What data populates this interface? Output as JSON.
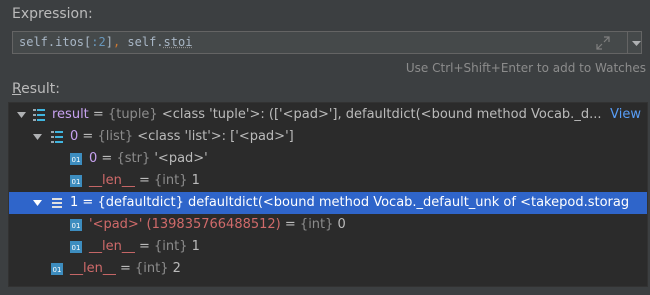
{
  "expression": {
    "label": "Expression:",
    "parts": [
      "self.itos[",
      ":2",
      "]",
      ",",
      " self.",
      "stoi"
    ]
  },
  "hint": "Use Ctrl+Shift+Enter to add to Watches",
  "result": {
    "label_underlined": "R",
    "label_rest": "esult:",
    "rows": [
      {
        "name": "result",
        "eq": " = ",
        "type": "{tuple}",
        "value": " <class 'tuple'>: (['<pad>'], defaultdict(<bound method Vocab._d...",
        "link": "View"
      },
      {
        "name": "0",
        "eq": " = ",
        "type": "{list}",
        "value": " <class 'list'>: ['<pad>']"
      },
      {
        "name": "0",
        "eq": " = ",
        "type": "{str}",
        "value": " '<pad>'"
      },
      {
        "name": "__len__",
        "eq": " = ",
        "type": "{int}",
        "value": " 1"
      },
      {
        "name": "1",
        "eq": " = ",
        "type": "{defaultdict}",
        "value": " defaultdict(<bound method Vocab._default_unk of <takepod.storag"
      },
      {
        "name": "'<pad>' (139835766488512)",
        "eq": " = ",
        "type": "{int}",
        "value": " 0"
      },
      {
        "name": "__len__",
        "eq": " = ",
        "type": "{int}",
        "value": " 1"
      },
      {
        "name": "__len__",
        "eq": " = ",
        "type": "{int}",
        "value": " 2"
      }
    ]
  },
  "icons": {
    "tuple_icon": "list-icon",
    "list_icon": "list-icon",
    "field_icon": "field-01-icon",
    "dict_icon": "dict-icon",
    "expand": "expand-arrows-icon",
    "dropdown": "chevron-down-icon"
  },
  "colors": {
    "background": "#3c3f41",
    "tree_background": "#2b2b2b",
    "selection": "#2f65ca",
    "name": "#c7a2f0",
    "key_name": "#cf6a6a",
    "type": "#8c8c8c",
    "link": "#589df6"
  }
}
